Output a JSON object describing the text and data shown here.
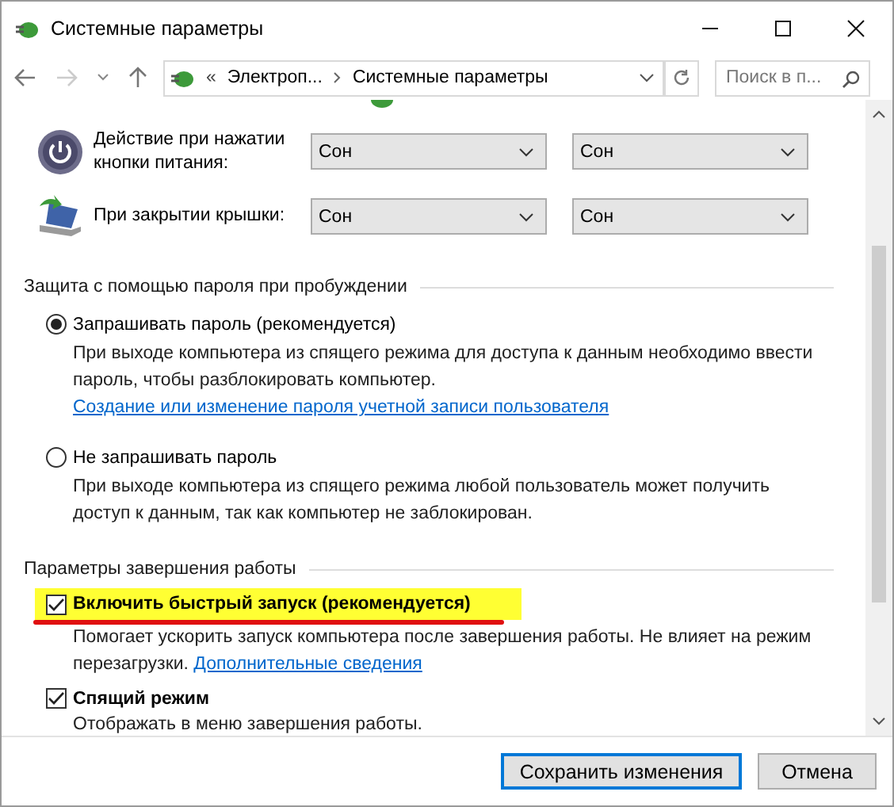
{
  "window": {
    "title": "Системные параметры"
  },
  "address_bar": {
    "overflow": "«",
    "breadcrumbs": [
      "Электроп...",
      "Системные параметры"
    ],
    "search_placeholder": "Поиск в п..."
  },
  "actions": [
    {
      "kind": "power",
      "label": "Действие при нажатии кнопки питания:",
      "values": [
        "Сон",
        "Сон"
      ]
    },
    {
      "kind": "lid",
      "label": "При закрытии крышки:",
      "values": [
        "Сон",
        "Сон"
      ]
    }
  ],
  "password_section": {
    "title": "Защита с помощью пароля при пробуждении",
    "options": [
      {
        "label": "Запрашивать пароль (рекомендуется)",
        "selected": true,
        "description": "При выходе компьютера из спящего режима для доступа к данным необходимо ввести пароль, чтобы разблокировать компьютер.",
        "link": "Создание или изменение пароля учетной записи пользователя"
      },
      {
        "label": "Не запрашивать пароль",
        "selected": false,
        "description": "При выходе компьютера из спящего режима любой пользователь может получить доступ к данным, так как компьютер не заблокирован."
      }
    ]
  },
  "shutdown_section": {
    "title": "Параметры завершения работы",
    "options": [
      {
        "label": "Включить быстрый запуск (рекомендуется)",
        "checked": true,
        "highlighted": true,
        "description": "Помогает ускорить запуск компьютера после завершения работы. Не влияет на режим перезагрузки.",
        "link": "Дополнительные сведения"
      },
      {
        "label": "Спящий режим",
        "checked": true,
        "highlighted": false,
        "description": "Отображать в меню завершения работы."
      }
    ]
  },
  "buttons": [
    {
      "label": "Сохранить изменения",
      "default": true
    },
    {
      "label": "Отмена",
      "default": false
    }
  ]
}
